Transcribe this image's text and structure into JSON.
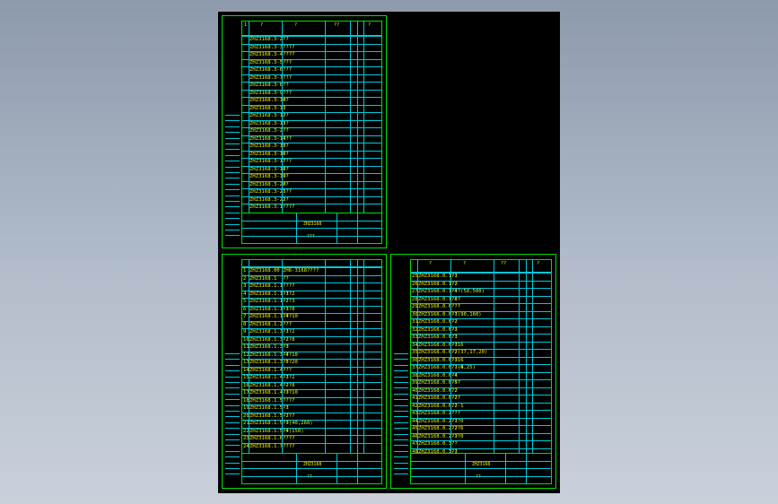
{
  "sheets": [
    {
      "id": "sheet-top-left",
      "header": {
        "num": "1",
        "code": "?",
        "name": "?",
        "qty": "??",
        "note": "?"
      },
      "left_label": "?? ",
      "rows": [
        {
          "num": "",
          "code": "ZHZ3168.3-2",
          "name": "??"
        },
        {
          "num": "",
          "code": "ZHZ3168.3-3",
          "name": "????"
        },
        {
          "num": "",
          "code": "ZHZ3168.3-4",
          "name": "????"
        },
        {
          "num": "",
          "code": "ZHZ3168.3-5",
          "name": "???"
        },
        {
          "num": "",
          "code": "ZHZ3168.3-6",
          "name": "???"
        },
        {
          "num": "",
          "code": "ZHZ3168.3-7",
          "name": "???"
        },
        {
          "num": "",
          "code": "ZHZ3168.3-8",
          "name": "??"
        },
        {
          "num": "",
          "code": "ZHZ3168.3-9",
          "name": "???"
        },
        {
          "num": "",
          "code": "ZHZ3168.3-10",
          "name": "??"
        },
        {
          "num": "",
          "code": "ZHZ3168.3-11",
          "name": "?"
        },
        {
          "num": "",
          "code": "ZHZ3168.3-12",
          "name": "??"
        },
        {
          "num": "",
          "code": "ZHZ3168.3-13",
          "name": "??"
        },
        {
          "num": "",
          "code": "ZHZ3168.3-2",
          "name": "??"
        },
        {
          "num": "",
          "code": "ZHZ3168.3-14",
          "name": "???"
        },
        {
          "num": "",
          "code": "ZHZ3168.3-15",
          "name": "??"
        },
        {
          "num": "",
          "code": "ZHZ3168.3-16",
          "name": "??"
        },
        {
          "num": "",
          "code": "ZHZ3168.3-17",
          "name": "???"
        },
        {
          "num": "",
          "code": "ZHZ3168.3-18",
          "name": "??"
        },
        {
          "num": "",
          "code": "ZHZ3168.3-19",
          "name": "??"
        },
        {
          "num": "",
          "code": "ZHZ3168.3-20",
          "name": "??"
        },
        {
          "num": "",
          "code": "ZHZ3168.3-21",
          "name": "???"
        },
        {
          "num": "",
          "code": "ZHZ3168.3-22",
          "name": "??"
        },
        {
          "num": "",
          "code": "ZHZ3168.3.1",
          "name": "????"
        }
      ],
      "title": {
        "drawing": "ZHZ3168",
        "sub": "???"
      }
    },
    {
      "id": "sheet-bottom-left",
      "header": {
        "num": "",
        "code": "",
        "name": "",
        "qty": "",
        "note": ""
      },
      "left_label": "?? ",
      "rows": [
        {
          "num": "1",
          "code": "ZHZ3168.00",
          "name": "ZH6-3168????"
        },
        {
          "num": "2",
          "code": "ZHZ3168.1",
          "name": "??"
        },
        {
          "num": "3",
          "code": "ZHZ3168.1.1",
          "name": "????"
        },
        {
          "num": "4",
          "code": "ZHZ3168.1.1-1",
          "name": "???2"
        },
        {
          "num": "5",
          "code": "ZHZ3168.1.1-2",
          "name": "???3"
        },
        {
          "num": "6",
          "code": "ZHZ3168.1.1-3",
          "name": "???8"
        },
        {
          "num": "7",
          "code": "ZHZ3168.1.1-4",
          "name": "???10"
        },
        {
          "num": "8",
          "code": "ZHZ3168.1.2",
          "name": "???"
        },
        {
          "num": "9",
          "code": "ZHZ3168.1.3-1",
          "name": "???2"
        },
        {
          "num": "10",
          "code": "ZHZ3168.1.3-2",
          "name": "???8"
        },
        {
          "num": "11",
          "code": "ZHZ3168.1.3-3",
          "name": "??"
        },
        {
          "num": "12",
          "code": "ZHZ3168.1.3-4",
          "name": "???10"
        },
        {
          "num": "13",
          "code": "ZHZ3168.1.3-5",
          "name": "???20"
        },
        {
          "num": "14",
          "code": "ZHZ3168.1.4",
          "name": "???"
        },
        {
          "num": "15",
          "code": "ZHZ3168.1.4-1",
          "name": "???2"
        },
        {
          "num": "16",
          "code": "ZHZ3168.1.4-2",
          "name": "???8"
        },
        {
          "num": "17",
          "code": "ZHZ3168.1.4-3",
          "name": "???10"
        },
        {
          "num": "18",
          "code": "ZHZ3168.1.5",
          "name": "????"
        },
        {
          "num": "19",
          "code": "ZHZ3168.1.5-1",
          "name": "??"
        },
        {
          "num": "20",
          "code": "ZHZ3168.1.5-2",
          "name": "????"
        },
        {
          "num": "21",
          "code": "ZHZ3168.1.5-3",
          "name": "??(40,260)"
        },
        {
          "num": "22",
          "code": "ZHZ3168.1.5-4",
          "name": "??(150)"
        },
        {
          "num": "23",
          "code": "ZHZ3168.1.6",
          "name": "????"
        },
        {
          "num": "24",
          "code": "ZHZ3168.1.7",
          "name": "????"
        }
      ],
      "title": {
        "drawing": "ZHZ3168",
        "sub": "??"
      }
    },
    {
      "id": "sheet-bottom-right",
      "header": {
        "num": "",
        "code": "?",
        "name": "?",
        "qty": "??",
        "note": "?"
      },
      "left_label": "",
      "rows": [
        {
          "num": "25",
          "code": "ZHZ3168.0.1-1",
          "name": "??"
        },
        {
          "num": "26",
          "code": "ZHZ3168.0.1-2",
          "name": "??"
        },
        {
          "num": "27",
          "code": "ZHZ3168.0.1-4",
          "name": "???(58,500)"
        },
        {
          "num": "28",
          "code": "ZHZ3168.0.1.8",
          "name": "???"
        },
        {
          "num": "29",
          "code": "ZHZ3168.0.6",
          "name": "???"
        },
        {
          "num": "30",
          "code": "ZHZ3168.0.6-1",
          "name": "??(90,160)"
        },
        {
          "num": "31",
          "code": "ZHZ3168.0.6-2",
          "name": "??"
        },
        {
          "num": "32",
          "code": "ZHZ3168.0.6-3",
          "name": "??"
        },
        {
          "num": "33",
          "code": "ZHZ3168.0.6.1",
          "name": "??"
        },
        {
          "num": "34",
          "code": "ZHZ3168.0.6-1",
          "name": "??16"
        },
        {
          "num": "35",
          "code": "ZHZ3168.0.6-2",
          "name": "??(37,17,20)"
        },
        {
          "num": "36",
          "code": "ZHZ3168.0.6-3",
          "name": "??16"
        },
        {
          "num": "37",
          "code": "ZHZ3168.0.6.1-4",
          "name": "??(5,25)"
        },
        {
          "num": "38",
          "code": "ZHZ3168.0.6-4",
          "name": "??"
        },
        {
          "num": "39",
          "code": "ZHZ3168.0.6-5",
          "name": "???"
        },
        {
          "num": "40",
          "code": "ZHZ3168.0.6.2",
          "name": "??"
        },
        {
          "num": "41",
          "code": "ZHZ3168.0.6-2",
          "name": "???"
        },
        {
          "num": "42",
          "code": "ZHZ3168.0.6.2-1",
          "name": "??"
        },
        {
          "num": "43",
          "code": "ZHZ3168.0.2",
          "name": "???"
        },
        {
          "num": "44",
          "code": "ZHZ3168.0.2-1",
          "name": "???0"
        },
        {
          "num": "45",
          "code": "ZHZ3168.0.2-2",
          "name": "???6"
        },
        {
          "num": "46",
          "code": "ZHZ3168.0.2-3",
          "name": "???0"
        },
        {
          "num": "47",
          "code": "ZHZ3168.0.3",
          "name": "??"
        },
        {
          "num": "48",
          "code": "ZHZ3168.0.3-1",
          "name": "??"
        }
      ],
      "title": {
        "drawing": "ZHZ3168",
        "sub": "??"
      }
    }
  ],
  "colors": {
    "frame": "#00e000",
    "grid": "#00c8d8",
    "text": "#e8f000",
    "background": "#000000"
  }
}
